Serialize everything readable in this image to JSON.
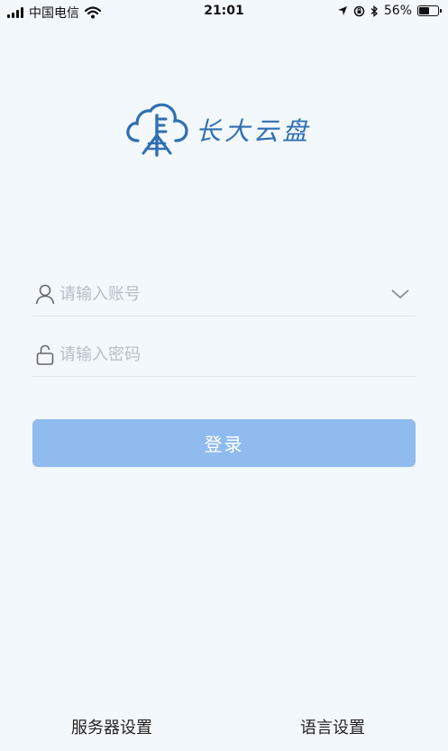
{
  "status_bar": {
    "carrier": "中国电信",
    "time": "21:01",
    "battery_percent": "56%",
    "battery_level": 0.56
  },
  "logo": {
    "text": "长大云盘",
    "icon": "cloud-logo-icon",
    "color": "#2f6fb2"
  },
  "account": {
    "placeholder": "请输入账号",
    "value": "",
    "icon": "user-icon"
  },
  "password": {
    "placeholder": "请输入密码",
    "value": "",
    "icon": "lock-icon"
  },
  "login_button": {
    "label": "登录",
    "color": "#8fbbef"
  },
  "footer": {
    "server_settings": "服务器设置",
    "language_settings": "语言设置"
  }
}
